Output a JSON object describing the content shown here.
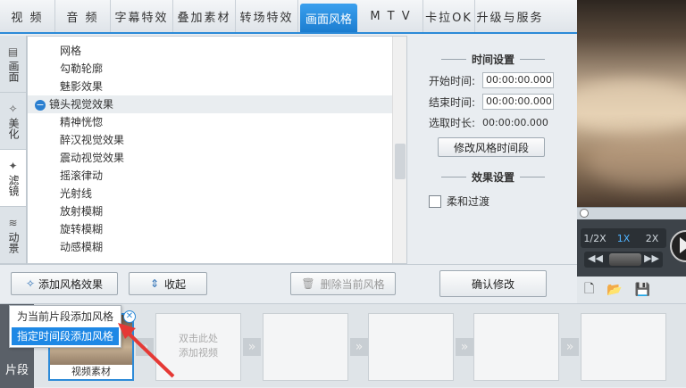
{
  "top_tabs": [
    {
      "label": "视 频"
    },
    {
      "label": "音 频"
    },
    {
      "label": "字幕特效"
    },
    {
      "label": "叠加素材"
    },
    {
      "label": "转场特效"
    },
    {
      "label": "画面风格",
      "active": true
    },
    {
      "label": "M T V"
    },
    {
      "label": "卡拉OK"
    },
    {
      "label": "升级与服务"
    }
  ],
  "side_tabs": [
    {
      "label": "画面",
      "icon": "monitor-icon"
    },
    {
      "label": "美化",
      "icon": "magic-wand-icon"
    },
    {
      "label": "滤镜",
      "icon": "filter-icon",
      "active": true
    },
    {
      "label": "动景",
      "icon": "wave-icon"
    }
  ],
  "list": [
    {
      "label": "网格"
    },
    {
      "label": "勾勒轮廓"
    },
    {
      "label": "魅影效果"
    },
    {
      "label": "镜头视觉效果",
      "group": true
    },
    {
      "label": "精神恍惚"
    },
    {
      "label": "醉汉视觉效果"
    },
    {
      "label": "震动视觉效果"
    },
    {
      "label": "摇滚律动"
    },
    {
      "label": "光射线"
    },
    {
      "label": "放射模糊"
    },
    {
      "label": "旋转模糊"
    },
    {
      "label": "动感模糊"
    }
  ],
  "settings": {
    "time_title": "时间设置",
    "start_label": "开始时间:",
    "start_value": "00:00:00.000",
    "end_label": "结束时间:",
    "end_value": "00:00:00.000",
    "duration_label": "选取时长:",
    "duration_value": "00:00:00.000",
    "modify_time_btn": "修改风格时间段",
    "effect_title": "效果设置",
    "smooth_label": "柔和过渡"
  },
  "actions": {
    "add_label": "添加风格效果",
    "fold_label": "收起",
    "delete_label": "删除当前风格",
    "confirm_label": "确认修改"
  },
  "popup": {
    "item1": "为当前片段添加风格",
    "item2": "指定时间段添加风格"
  },
  "player": {
    "speeds": [
      "1/2X",
      "1X",
      "2X"
    ],
    "active_speed": "1X"
  },
  "timeline": {
    "side_label": "片段",
    "first_clip_caption": "视频素材",
    "empty_hint_line1": "双击此处",
    "empty_hint_line2": "添加视频"
  }
}
